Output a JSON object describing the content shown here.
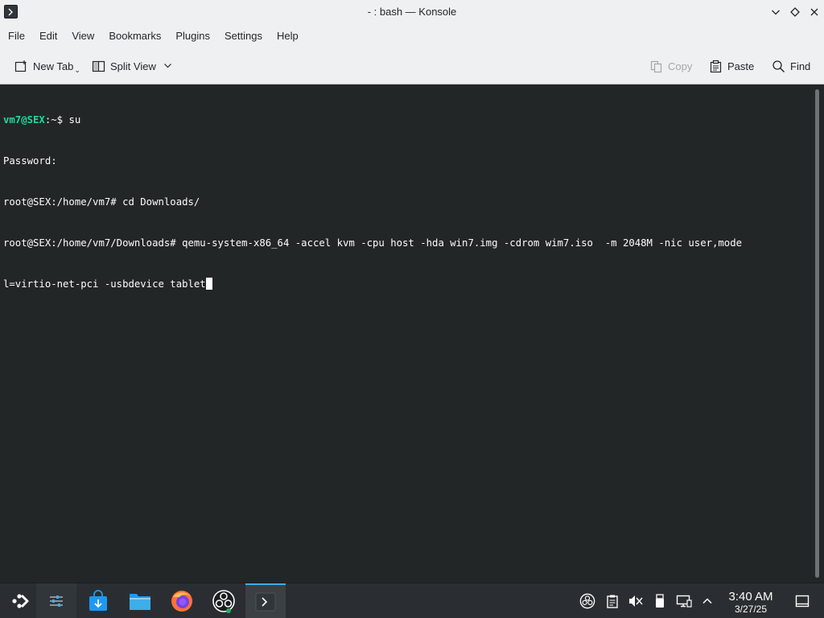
{
  "window": {
    "title": "- : bash — Konsole"
  },
  "menu": [
    "File",
    "Edit",
    "View",
    "Bookmarks",
    "Plugins",
    "Settings",
    "Help"
  ],
  "toolbar": {
    "new_tab": "New Tab",
    "split_view": "Split View",
    "copy": "Copy",
    "paste": "Paste",
    "find": "Find"
  },
  "terminal": {
    "line1_user": "vm7@SEX",
    "line1_rest": ":~$ su",
    "line2": "Password:",
    "line3": "root@SEX:/home/vm7# cd Downloads/",
    "line4": "root@SEX:/home/vm7/Downloads# qemu-system-x86_64 -accel kvm -cpu host -hda win7.img -cdrom wim7.iso  -m 2048M -nic user,mode",
    "line5": "l=virtio-net-pci -usbdevice tablet"
  },
  "taskbar": {
    "apps": [
      "application-launcher-icon",
      "system-settings-icon",
      "discover-store-icon",
      "dolphin-file-manager-icon",
      "firefox-icon",
      "obs-studio-icon",
      "konsole-icon"
    ]
  },
  "clock": {
    "time": "3:40 AM",
    "date": "3/27/25"
  },
  "colors": {
    "terminal_bg": "#232627",
    "prompt_green": "#1cdc9a",
    "chrome_bg": "#eff0f1",
    "taskbar_bg": "#2a2e32",
    "accent": "#3daee9"
  }
}
